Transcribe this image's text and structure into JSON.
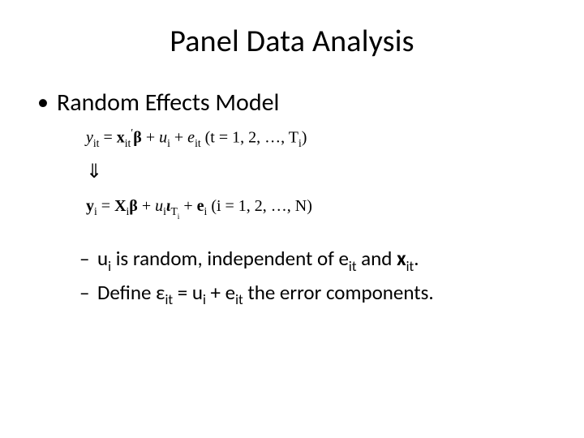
{
  "title": "Panel Data Analysis",
  "heading": "Random Effects Model",
  "equation1": {
    "y": "y",
    "y_sub": "it",
    "eq": " = ",
    "x": "x",
    "x_sub": "it",
    "prime": "′",
    "beta": "β",
    "plus1": " + ",
    "u": "u",
    "u_sub": "i",
    "plus2": " + ",
    "e": "e",
    "e_sub": "it",
    "range": " (t = 1, 2, …, T",
    "range_sub": "i",
    "range_close": ")"
  },
  "arrow": "⇓",
  "equation2": {
    "y": "y",
    "y_sub": "i",
    "eq": " = ",
    "X": "X",
    "X_sub": "i",
    "beta": "β",
    "plus1": " + ",
    "u": "u",
    "u_sub": "i",
    "iota": "ι",
    "iota_sub": "T",
    "iota_subsub": "i",
    "plus2": " + ",
    "e": "e",
    "e_sub": "i",
    "range": "  (i = 1, 2, …, N)"
  },
  "note1": {
    "pre": "u",
    "sub1": "i",
    "mid1": " is random, independent of e",
    "sub2": "it",
    "mid2": " and ",
    "bold": "x",
    "sub3": "it",
    "end": "."
  },
  "note2": {
    "pre": "Define ε",
    "sub1": "it",
    "mid1": " = u",
    "sub2": "i",
    "mid2": " + e",
    "sub3": "it",
    "end": " the error components."
  }
}
